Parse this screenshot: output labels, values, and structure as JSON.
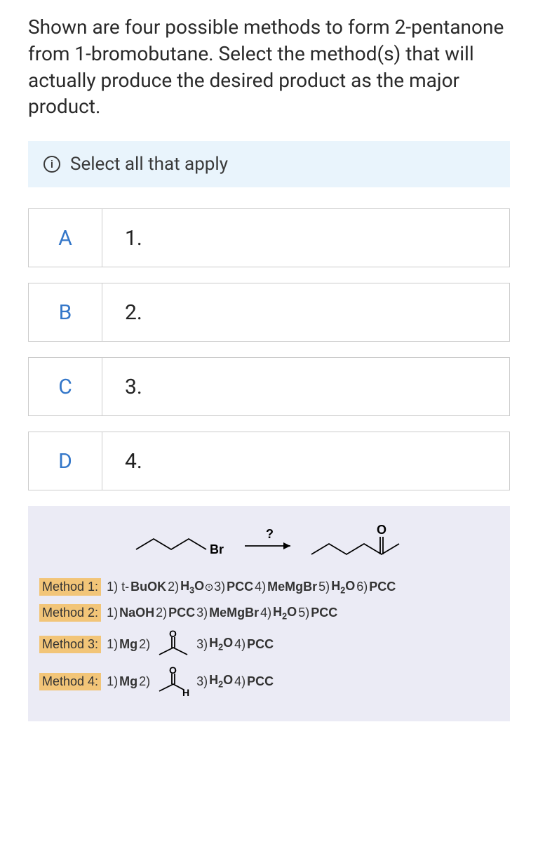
{
  "question": "Shown are four possible methods to form 2-pentanone from 1-bromobutane. Select the method(s) that will actually produce the desired product as the major product.",
  "instruction": "Select all that apply",
  "options": [
    {
      "letter": "A",
      "label": "1."
    },
    {
      "letter": "B",
      "label": "2."
    },
    {
      "letter": "C",
      "label": "3."
    },
    {
      "letter": "D",
      "label": "4."
    }
  ],
  "reaction": {
    "start_smiles": "CCCCBr",
    "start_label": "Br",
    "arrow_label": "?",
    "product_smiles": "CCCC(=O)C",
    "product_label": "O"
  },
  "methods": [
    {
      "label": "Method 1:",
      "steps_html": "1) t-<b>BuOK</b>  2) <b>H<sub>3</sub>O</b><span class='plus-circle'>+</span>  3) <b>PCC</b>  4) <b>MeMgBr</b>  5) <b>H<sub>2</sub>O</b>  6) <b>PCC</b>"
    },
    {
      "label": "Method 2:",
      "steps_html": "1) <b>NaOH</b>  2) <b>PCC</b>  3) <b>MeMgBr</b>  4) <b>H<sub>2</sub>O</b>  5) <b>PCC</b>"
    },
    {
      "label": "Method 3:",
      "steps_html": "1) <b>Mg</b>  2)",
      "struct": "acetone",
      "after_html": "3) <b>H<sub>2</sub>O</b>  4) <b>PCC</b>"
    },
    {
      "label": "Method 4:",
      "steps_html": "1) <b>Mg</b>  2)",
      "struct": "acetaldehyde",
      "after_html": "3) <b>H<sub>2</sub>O</b>  4) <b>PCC</b>"
    }
  ]
}
